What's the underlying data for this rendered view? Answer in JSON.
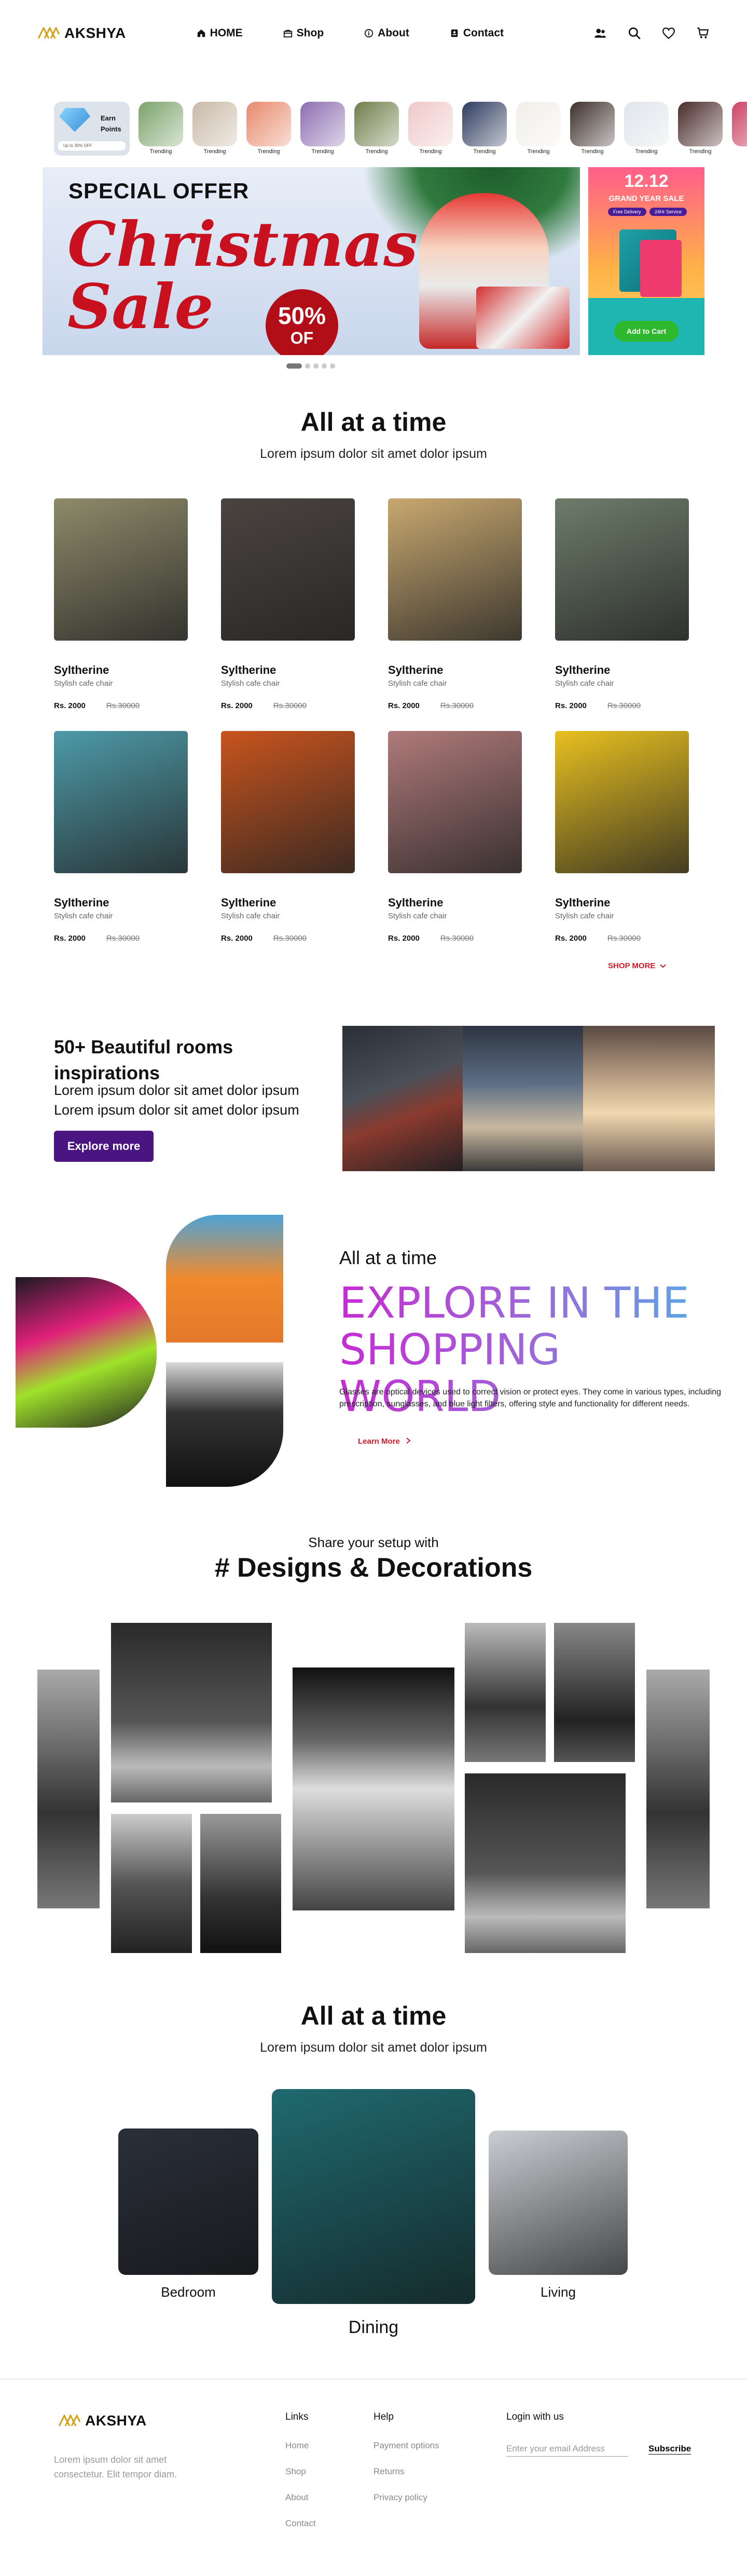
{
  "brand": {
    "name": "AKSHYA",
    "accent": "#d4a017"
  },
  "nav": [
    {
      "label": "HOME",
      "icon": "home-icon"
    },
    {
      "label": "Shop",
      "icon": "bag-icon"
    },
    {
      "label": "About",
      "icon": "info-icon"
    },
    {
      "label": "Contact",
      "icon": "contact-icon"
    }
  ],
  "header_icons": [
    "user-icon",
    "search-icon",
    "heart-icon",
    "cart-icon"
  ],
  "category_strip": {
    "first": {
      "title_line1": "Earn",
      "title_line2": "Points",
      "promo": "Up to 30% OFF"
    },
    "items": [
      {
        "label": "Trending",
        "color": "#7aa36a"
      },
      {
        "label": "Trending",
        "color": "#c9b9a6"
      },
      {
        "label": "Trending",
        "color": "#e88a6d"
      },
      {
        "label": "Trending",
        "color": "#8c6db0"
      },
      {
        "label": "Trending",
        "color": "#6f7f4a"
      },
      {
        "label": "Trending",
        "color": "#f0c8c8"
      },
      {
        "label": "Trending",
        "color": "#2e3b5e"
      },
      {
        "label": "Trending",
        "color": "#f2efe9"
      },
      {
        "label": "Trending",
        "color": "#3d2f2a"
      },
      {
        "label": "Trending",
        "color": "#dfe5ea"
      },
      {
        "label": "Trending",
        "color": "#4a2a2a"
      },
      {
        "label": "Tr",
        "color": "#cc4466"
      }
    ]
  },
  "hero": {
    "special": "SPECIAL OFFER",
    "line1": "Christmas",
    "line2": "Sale",
    "percent": "50%",
    "off": "OF",
    "main_color": "#c8101e"
  },
  "promo_card": {
    "year": "12.12",
    "title": "GRAND YEAR SALE",
    "chip1": "Free Delivery",
    "chip2": "24Hr Service",
    "button": "Add to Cart"
  },
  "section1": {
    "title": "All at a time",
    "subtitle": "Lorem ipsum dolor sit amet dolor ipsum"
  },
  "products": [
    {
      "name": "Syltherine",
      "desc": "Stylish cafe chair",
      "price": "Rs. 2000",
      "old_price": "Rs.30000",
      "color": "#8e8a6a"
    },
    {
      "name": "Syltherine",
      "desc": "Stylish cafe chair",
      "price": "Rs. 2000",
      "old_price": "Rs.30000",
      "color": "#4a4440"
    },
    {
      "name": "Syltherine",
      "desc": "Stylish cafe chair",
      "price": "Rs. 2000",
      "old_price": "Rs.30000",
      "color": "#c8a870"
    },
    {
      "name": "Syltherine",
      "desc": "Stylish cafe chair",
      "price": "Rs. 2000",
      "old_price": "Rs.30000",
      "color": "#6d7d6a"
    },
    {
      "name": "Syltherine",
      "desc": "Stylish cafe chair",
      "price": "Rs. 2000",
      "old_price": "Rs.30000",
      "color": "#4d9aa8"
    },
    {
      "name": "Syltherine",
      "desc": "Stylish cafe chair",
      "price": "Rs. 2000",
      "old_price": "Rs.30000",
      "color": "#c8541e"
    },
    {
      "name": "Syltherine",
      "desc": "Stylish cafe chair",
      "price": "Rs. 2000",
      "old_price": "Rs.30000",
      "color": "#b07a7a"
    },
    {
      "name": "Syltherine",
      "desc": "Stylish cafe chair",
      "price": "Rs. 2000",
      "old_price": "Rs.30000",
      "color": "#e8c020"
    }
  ],
  "shop_more": "SHOP MORE",
  "inspirations": {
    "title": "50+ Beautiful  rooms inspirations",
    "text1": "Lorem ipsum dolor sit amet dolor ipsum",
    "text2": "Lorem ipsum dolor sit amet dolor ipsum",
    "button": "Explore more",
    "button_color": "#4a1580"
  },
  "explore": {
    "small": "All at a time",
    "big": "EXPLORE IN THE SHOPPING WORLD",
    "body": "Glasses are optical devices used to correct vision or protect eyes. They come in various types, including prescription, sunglasses, and blue light filters, offering style and functionality for different needs.",
    "link": "Learn More"
  },
  "designs": {
    "subtitle": "Share your setup with",
    "title": "# Designs & Decorations"
  },
  "section2": {
    "title": "All at a time",
    "subtitle": "Lorem ipsum dolor sit amet dolor ipsum"
  },
  "rooms": [
    {
      "label": "Bedroom",
      "color": "#2a2f3a"
    },
    {
      "label": "Dining",
      "color": "#1f6a70"
    },
    {
      "label": "Living",
      "color": "#c9ced2"
    }
  ],
  "footer": {
    "brand": "AKSHYA",
    "about": "Lorem ipsum dolor sit amet consectetur. Elit tempor diam.",
    "links_title": "Links",
    "links": [
      "Home",
      "Shop",
      "About",
      "Contact"
    ],
    "help_title": "Help",
    "help": [
      "Payment options",
      "Returns",
      "Privacy policy"
    ],
    "login_title": "Login with us",
    "email_placeholder": "Enter your email Address",
    "subscribe": "Subscribe"
  }
}
